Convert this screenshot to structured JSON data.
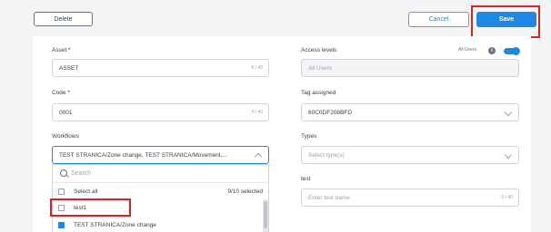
{
  "toolbar": {
    "delete_label": "Delete",
    "cancel_label": "Cancel",
    "save_label": "Save"
  },
  "form": {
    "asset": {
      "label": "Asset *",
      "value": "ASSET",
      "counter": "5 / 40"
    },
    "code": {
      "label": "Code *",
      "value": "0001",
      "counter": "4 / 40"
    },
    "workflows": {
      "label": "Workflows",
      "value": "TEST STRANICA/Zone change, TEST STRANICA/Movement,..."
    },
    "access_levels": {
      "label": "Access levels",
      "toggle_label": "All Users",
      "placeholder": "All Users",
      "toggle_on": true
    },
    "tag_assigned": {
      "label": "Tag assigned",
      "value": "60C0DF208BFD"
    },
    "types": {
      "label": "Types",
      "placeholder": "Select type(s)"
    },
    "test": {
      "label": "test",
      "placeholder": "Enter test name",
      "counter": "0 / 40"
    }
  },
  "workflow_dropdown": {
    "search_placeholder": "Search",
    "select_all_label": "Select all",
    "selected_count": "9/10 selected",
    "options": [
      {
        "label": "test1",
        "checked": false
      },
      {
        "label": "TEST STRANICA/Zone change",
        "checked": true
      }
    ]
  },
  "colors": {
    "primary": "#1e88e5",
    "highlight": "#e02020"
  }
}
